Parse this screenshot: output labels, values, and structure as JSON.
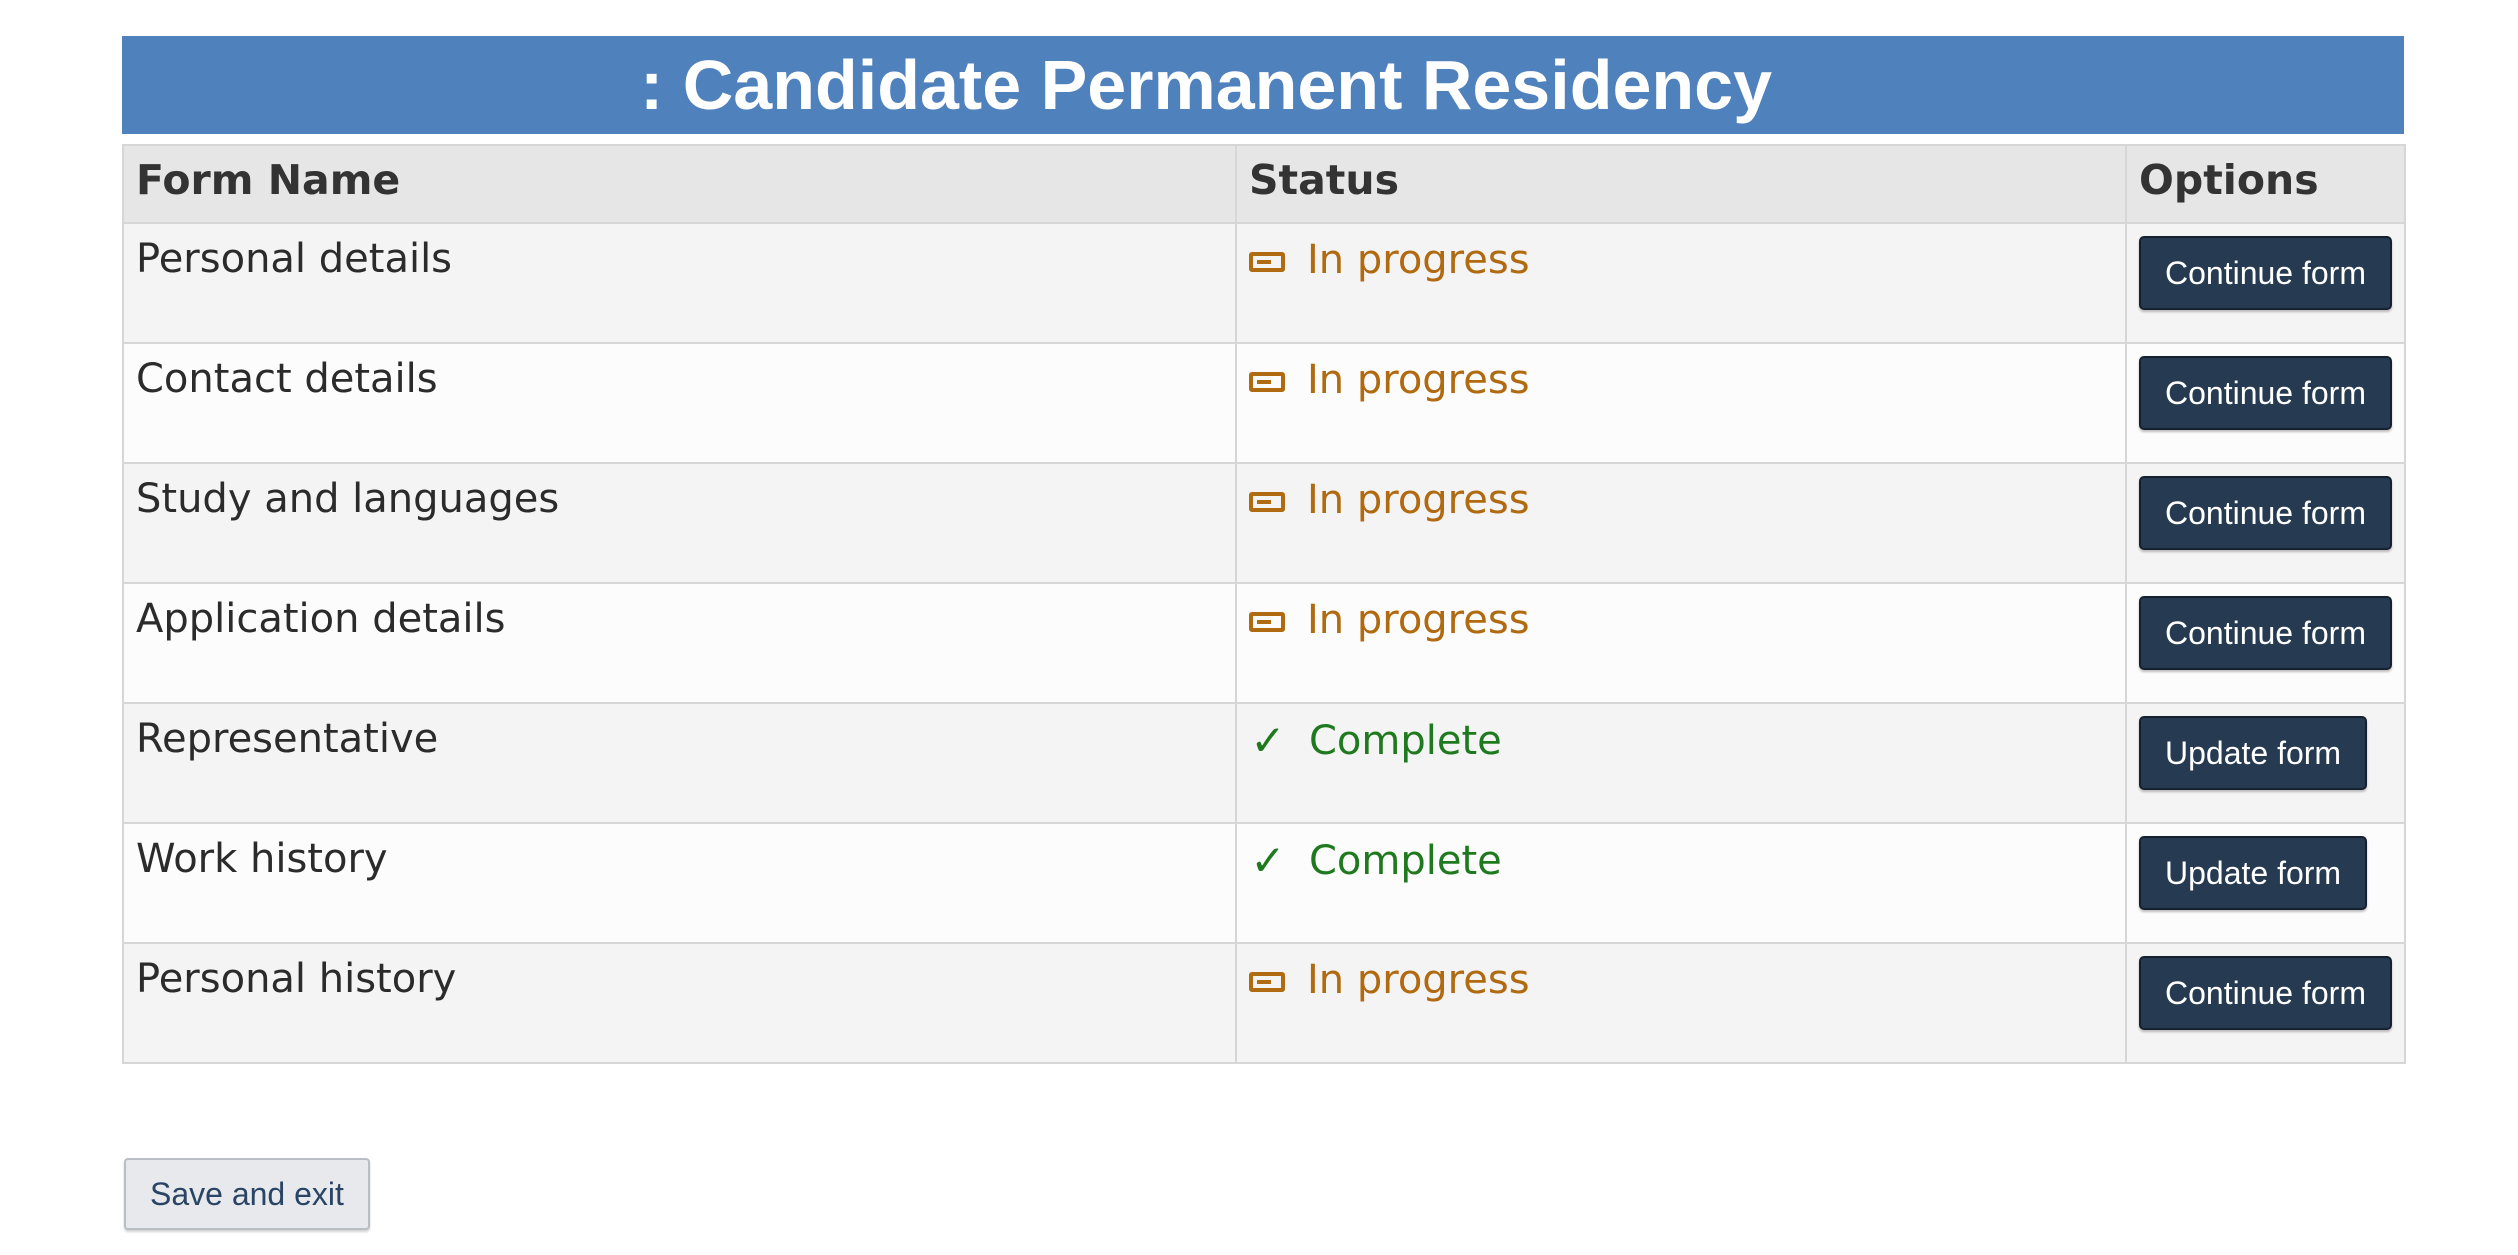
{
  "page": {
    "title": ": Candidate Permanent Residency"
  },
  "table": {
    "headers": {
      "name": "Form Name",
      "status": "Status",
      "options": "Options"
    },
    "rows": [
      {
        "name": "Personal details",
        "status": "In progress",
        "status_type": "in-progress",
        "status_icon": "progress-icon",
        "action": "Continue form"
      },
      {
        "name": "Contact details",
        "status": "In progress",
        "status_type": "in-progress",
        "status_icon": "progress-icon",
        "action": "Continue form"
      },
      {
        "name": "Study and languages",
        "status": "In progress",
        "status_type": "in-progress",
        "status_icon": "progress-icon",
        "action": "Continue form"
      },
      {
        "name": "Application details",
        "status": "In progress",
        "status_type": "in-progress",
        "status_icon": "progress-icon",
        "action": "Continue form"
      },
      {
        "name": "Representative",
        "status": "Complete",
        "status_type": "complete",
        "status_icon": "check-icon",
        "action": "Update form"
      },
      {
        "name": "Work history",
        "status": "Complete",
        "status_type": "complete",
        "status_icon": "check-icon",
        "action": "Update form"
      },
      {
        "name": "Personal history",
        "status": "In progress",
        "status_type": "in-progress",
        "status_icon": "progress-icon",
        "action": "Continue form"
      }
    ]
  },
  "footer": {
    "save_exit_label": "Save and exit"
  },
  "colors": {
    "title_bar": "#4f81bd",
    "in_progress": "#b06a10",
    "complete": "#1f7a1f",
    "primary_button": "#263a52"
  }
}
